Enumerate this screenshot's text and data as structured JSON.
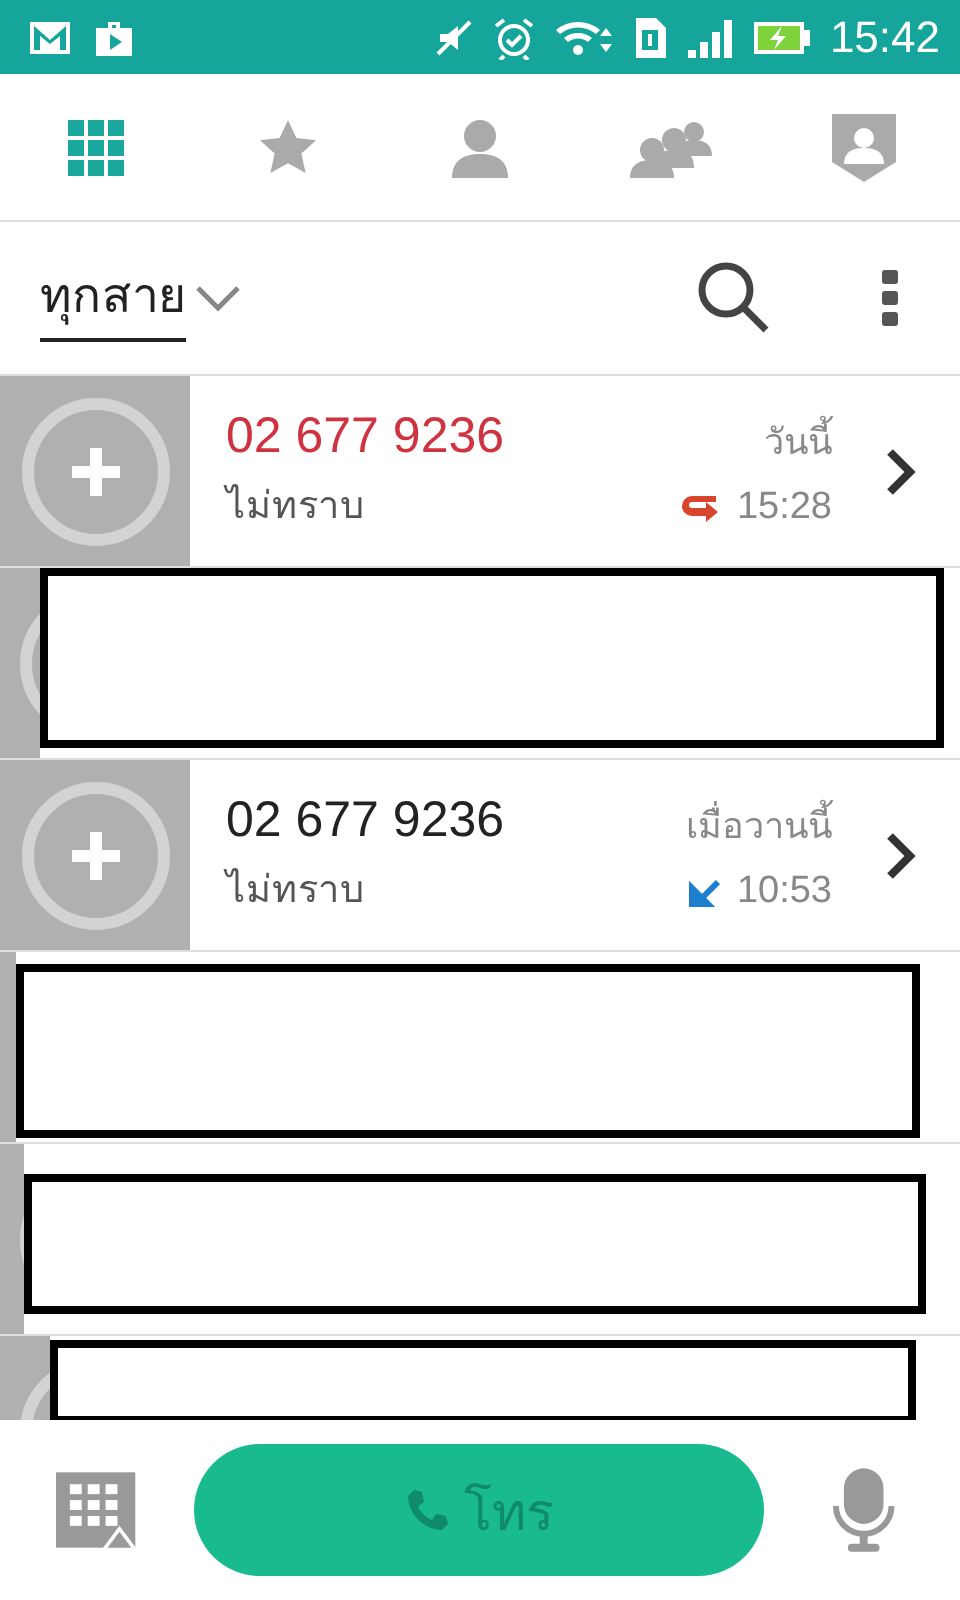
{
  "status_bar": {
    "time": "15:42"
  },
  "tabs": [
    {
      "kind": "dialpad",
      "selected": true
    },
    {
      "kind": "favorites",
      "selected": false
    },
    {
      "kind": "contact",
      "selected": false
    },
    {
      "kind": "groups",
      "selected": false
    },
    {
      "kind": "profile",
      "selected": false
    }
  ],
  "filter": {
    "label": "ทุกสาย"
  },
  "calls": [
    {
      "kind": "call",
      "number": "02 677 9236",
      "label": "ไม่ทราบ",
      "day": "วันนี้",
      "time": "15:28",
      "missed": true
    },
    {
      "kind": "redacted"
    },
    {
      "kind": "call",
      "number": "02 677 9236",
      "label": "ไม่ทราบ",
      "day": "เมื่อวานนี้",
      "time": "10:53",
      "missed": false
    },
    {
      "kind": "redacted"
    },
    {
      "kind": "redacted"
    },
    {
      "kind": "redacted"
    }
  ],
  "call_button": {
    "label": "โทร"
  }
}
